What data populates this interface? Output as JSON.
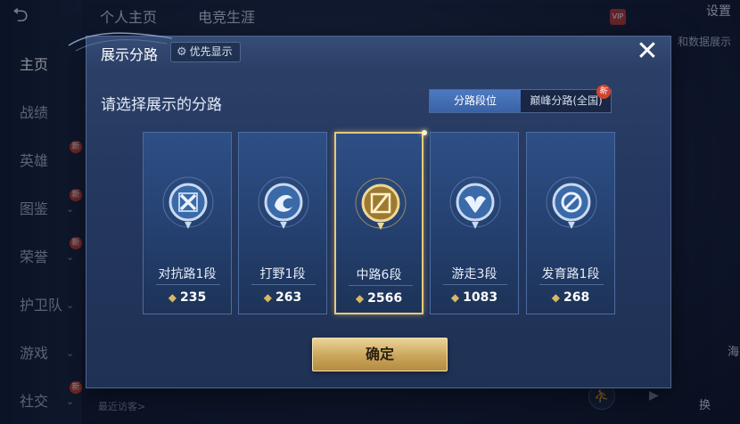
{
  "background": {
    "back_symbol": "⮌",
    "top_tabs": [
      "个人主页",
      "电竞生涯"
    ],
    "settings_label": "设置",
    "vip_label": "VIP",
    "hint_text": "和数据展示",
    "sidebar_items": [
      {
        "label": "主页",
        "active": true,
        "new": false,
        "chevron": false
      },
      {
        "label": "战绩",
        "active": false,
        "new": false,
        "chevron": false
      },
      {
        "label": "英雄",
        "active": false,
        "new": true,
        "chevron": false
      },
      {
        "label": "图鉴",
        "active": false,
        "new": true,
        "chevron": true
      },
      {
        "label": "荣誉",
        "active": false,
        "new": true,
        "chevron": true
      },
      {
        "label": "护卫队",
        "active": false,
        "new": false,
        "chevron": true
      },
      {
        "label": "游戏",
        "active": false,
        "new": false,
        "chevron": true
      },
      {
        "label": "社交",
        "active": false,
        "new": true,
        "chevron": true
      }
    ],
    "new_badge_text": "新",
    "recent_visitors": "最近访客>",
    "bottom_right_label": "换",
    "right_side_label": "海"
  },
  "modal": {
    "title": "展示分路",
    "priority_label": "优先显示",
    "close_symbol": "✕",
    "subtitle": "请选择展示的分路",
    "segments": {
      "active": "分路段位",
      "inactive": "巅峰分路(全国)",
      "new_badge": "新"
    },
    "cards": [
      {
        "label": "对抗路1段",
        "score": "235",
        "emblem": "shield-cross-icon",
        "selected": false
      },
      {
        "label": "打野1段",
        "score": "263",
        "emblem": "dragon-claw-icon",
        "selected": false
      },
      {
        "label": "中路6段",
        "score": "2566",
        "emblem": "slash-rune-icon",
        "selected": true
      },
      {
        "label": "游走3段",
        "score": "1083",
        "emblem": "wing-guard-icon",
        "selected": false
      },
      {
        "label": "发育路1段",
        "score": "268",
        "emblem": "target-ring-icon",
        "selected": false
      }
    ],
    "confirm_label": "确定"
  },
  "colors": {
    "accent_gold": "#e7c97d",
    "segment_active": "#4d7ac2",
    "badge_red": "#d0432f"
  }
}
